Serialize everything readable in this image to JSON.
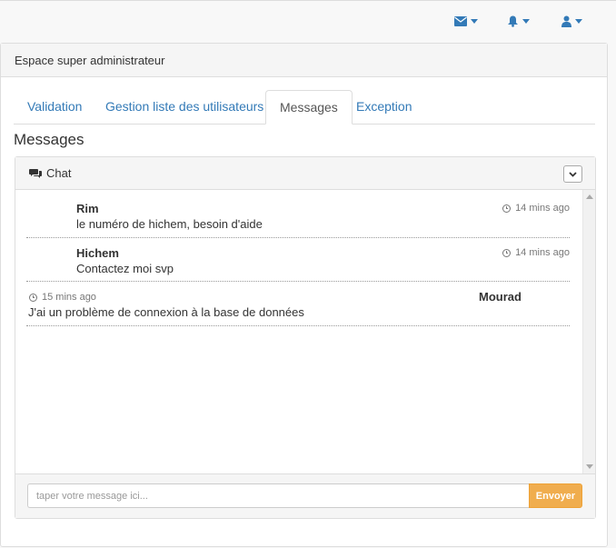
{
  "topnav": {
    "items": [
      {
        "icon": "envelope-icon"
      },
      {
        "icon": "bell-icon"
      },
      {
        "icon": "user-icon"
      }
    ]
  },
  "colors": {
    "link": "#337ab7",
    "warning": "#f0ad4e",
    "panel_bg": "#f5f5f5"
  },
  "panel": {
    "title": "Espace super administrateur"
  },
  "tabs": [
    {
      "label": "Validation"
    },
    {
      "label": "Gestion liste des utilisateurs"
    },
    {
      "label": "Messages",
      "active": true
    },
    {
      "label": "Exception"
    }
  ],
  "section": {
    "title": "Messages"
  },
  "chat": {
    "title": "Chat",
    "messages": [
      {
        "author": "Rim",
        "text": "le numéro de hichem, besoin d'aide",
        "time": "14 mins ago"
      },
      {
        "author": "Hichem",
        "text": "Contactez moi svp",
        "time": "14 mins ago"
      },
      {
        "author": "Mourad",
        "text": "J'ai un problème de connexion à la base de données",
        "time": "15 mins ago"
      }
    ],
    "input_placeholder": "taper votre message ici...",
    "send_label": "Envoyer"
  }
}
